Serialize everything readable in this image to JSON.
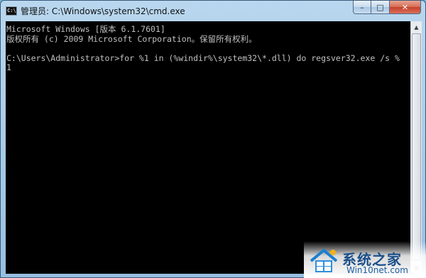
{
  "window": {
    "title": "管理员: C:\\Windows\\system32\\cmd.exe",
    "icon": "cmd-icon",
    "icon_glyph": "C:\\",
    "buttons": {
      "minimize": "–",
      "maximize": "□",
      "close": "✕"
    }
  },
  "console": {
    "lines": [
      "Microsoft Windows [版本 6.1.7601]",
      "版权所有 (c) 2009 Microsoft Corporation。保留所有权利。",
      "",
      "C:\\Users\\Administrator>for %1 in (%windir%\\system32\\*.dll) do regsver32.exe /s %",
      "1"
    ]
  },
  "scrollbar": {
    "up_arrow": "▲",
    "down_arrow": "▼"
  },
  "watermark": {
    "name": "系统之家",
    "url": "Win10net.com",
    "colors": {
      "text": "#1a4f8a",
      "url": "#1d5fa3"
    }
  }
}
